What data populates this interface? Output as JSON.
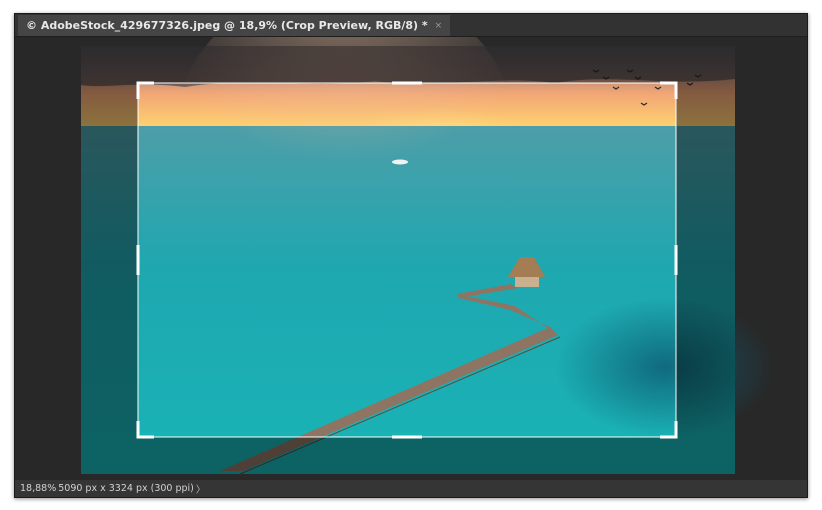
{
  "document": {
    "tab_title": "© AdobeStock_429677326.jpeg @ 18,9% (Crop Preview, RGB/8) *",
    "close_glyph": "×"
  },
  "status": {
    "zoom": "18,88%",
    "doc_info": "5090 px x 3324 px (300 ppi)",
    "arrow_glyph": "〉"
  },
  "tool": {
    "name": "Crop Tool",
    "mode": "Crop Preview"
  },
  "colors": {
    "ui_dark": "#282828",
    "crop_frame": "#ffffff",
    "sea": "#1fa7b0",
    "sunset": "#f6b765"
  }
}
